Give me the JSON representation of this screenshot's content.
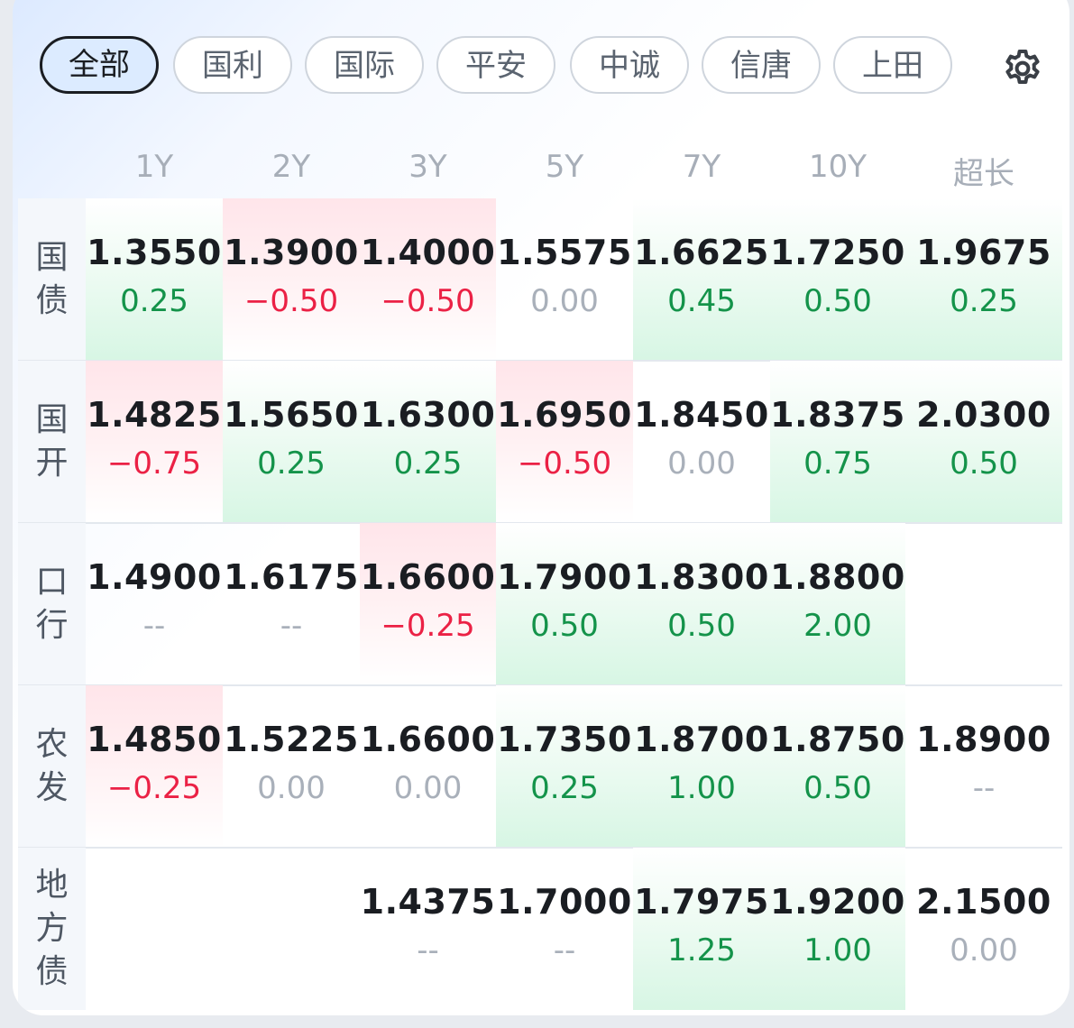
{
  "tabs": [
    {
      "label": "全部",
      "active": true
    },
    {
      "label": "国利",
      "active": false
    },
    {
      "label": "国际",
      "active": false
    },
    {
      "label": "平安",
      "active": false
    },
    {
      "label": "中诚",
      "active": false
    },
    {
      "label": "信唐",
      "active": false
    },
    {
      "label": "上田",
      "active": false
    }
  ],
  "settings_icon": "gear-icon",
  "columns": [
    "1Y",
    "2Y",
    "3Y",
    "5Y",
    "7Y",
    "10Y",
    "超长"
  ],
  "colors": {
    "up": "#14934a",
    "down": "#eb2145",
    "neutral": "#a9b0ba",
    "up_bg": "#d7f6e4",
    "down_bg": "#ffe5ea"
  },
  "rows": [
    {
      "label": "国债",
      "cells": [
        {
          "value": "1.3550",
          "change": "0.25",
          "dir": "up"
        },
        {
          "value": "1.3900",
          "change": "−0.50",
          "dir": "down"
        },
        {
          "value": "1.4000",
          "change": "−0.50",
          "dir": "down"
        },
        {
          "value": "1.5575",
          "change": "0.00",
          "dir": "flat"
        },
        {
          "value": "1.6625",
          "change": "0.45",
          "dir": "up"
        },
        {
          "value": "1.7250",
          "change": "0.50",
          "dir": "up"
        },
        {
          "value": "1.9675",
          "change": "0.25",
          "dir": "up"
        }
      ]
    },
    {
      "label": "国开",
      "cells": [
        {
          "value": "1.4825",
          "change": "−0.75",
          "dir": "down"
        },
        {
          "value": "1.5650",
          "change": "0.25",
          "dir": "up"
        },
        {
          "value": "1.6300",
          "change": "0.25",
          "dir": "up"
        },
        {
          "value": "1.6950",
          "change": "−0.50",
          "dir": "down"
        },
        {
          "value": "1.8450",
          "change": "0.00",
          "dir": "flat"
        },
        {
          "value": "1.8375",
          "change": "0.75",
          "dir": "up"
        },
        {
          "value": "2.0300",
          "change": "0.50",
          "dir": "up"
        }
      ]
    },
    {
      "label": "口行",
      "cells": [
        {
          "value": "1.4900",
          "change": "--",
          "dir": "none"
        },
        {
          "value": "1.6175",
          "change": "--",
          "dir": "none"
        },
        {
          "value": "1.6600",
          "change": "−0.25",
          "dir": "down"
        },
        {
          "value": "1.7900",
          "change": "0.50",
          "dir": "up"
        },
        {
          "value": "1.8300",
          "change": "0.50",
          "dir": "up"
        },
        {
          "value": "1.8800",
          "change": "2.00",
          "dir": "up"
        },
        {
          "value": "",
          "change": "",
          "dir": "empty"
        }
      ]
    },
    {
      "label": "农发",
      "cells": [
        {
          "value": "1.4850",
          "change": "−0.25",
          "dir": "down"
        },
        {
          "value": "1.5225",
          "change": "0.00",
          "dir": "flat"
        },
        {
          "value": "1.6600",
          "change": "0.00",
          "dir": "flat"
        },
        {
          "value": "1.7350",
          "change": "0.25",
          "dir": "up"
        },
        {
          "value": "1.8700",
          "change": "1.00",
          "dir": "up"
        },
        {
          "value": "1.8750",
          "change": "0.50",
          "dir": "up"
        },
        {
          "value": "1.8900",
          "change": "--",
          "dir": "none"
        }
      ]
    },
    {
      "label": "地方债",
      "cells": [
        {
          "value": "",
          "change": "",
          "dir": "empty"
        },
        {
          "value": "",
          "change": "",
          "dir": "empty"
        },
        {
          "value": "1.4375",
          "change": "--",
          "dir": "none"
        },
        {
          "value": "1.7000",
          "change": "--",
          "dir": "none"
        },
        {
          "value": "1.7975",
          "change": "1.25",
          "dir": "up"
        },
        {
          "value": "1.9200",
          "change": "1.00",
          "dir": "up"
        },
        {
          "value": "2.1500",
          "change": "0.00",
          "dir": "flat"
        }
      ]
    }
  ]
}
